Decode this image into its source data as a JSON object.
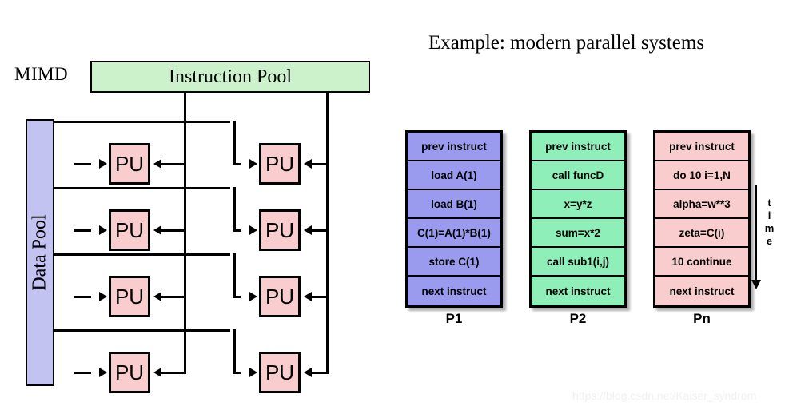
{
  "diagram": {
    "model_label": "MIMD",
    "instruction_pool_label": "Instruction Pool",
    "data_pool_label": "Data Pool",
    "pu_label": "PU",
    "pu_count": 8,
    "pu_rows": 4,
    "pu_columns": 2,
    "colors": {
      "instruction_pool": "#ccf2cc",
      "data_pool": "#c3c3f2",
      "pu": "#f9cdcd",
      "outline": "#000000"
    }
  },
  "example": {
    "title": "Example: modern parallel systems",
    "time_axis_label": "time",
    "processes": [
      {
        "label": "P1",
        "color": "#9a9aee",
        "instructions": [
          "prev instruct",
          "load A(1)",
          "load B(1)",
          "C(1)=A(1)*B(1)",
          "store C(1)",
          "next instruct"
        ]
      },
      {
        "label": "P2",
        "color": "#8fefb8",
        "instructions": [
          "prev instruct",
          "call funcD",
          "x=y*z",
          "sum=x*2",
          "call sub1(i,j)",
          "next instruct"
        ]
      },
      {
        "label": "Pn",
        "color": "#f9cdcd",
        "instructions": [
          "prev instruct",
          "do 10 i=1,N",
          "alpha=w**3",
          "zeta=C(i)",
          "10 continue",
          "next instruct"
        ]
      }
    ]
  },
  "watermark": {
    "text": "https://blog.csdn.net/Kaiser_syndrom"
  }
}
